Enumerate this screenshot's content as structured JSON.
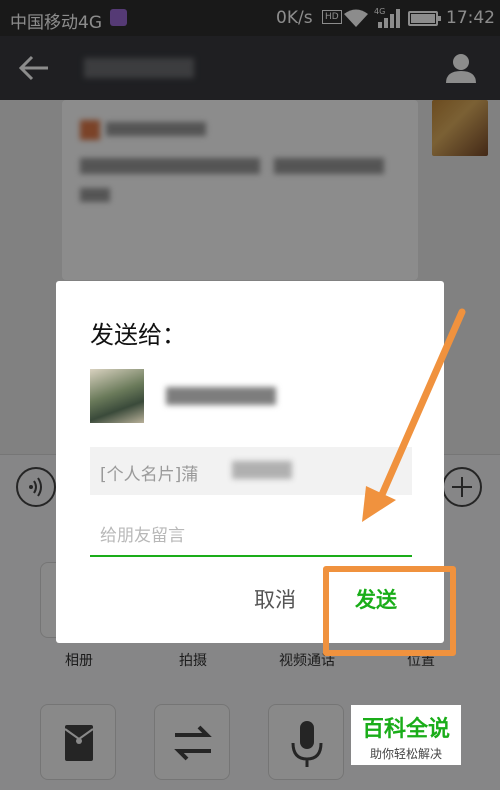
{
  "status_bar": {
    "carrier": "中国移动4G",
    "net_speed": "0K/s",
    "hd_badge": "HD",
    "network_type": "4G",
    "time": "17:42"
  },
  "panel": {
    "items": [
      {
        "label": "相册",
        "icon": "album-icon"
      },
      {
        "label": "拍摄",
        "icon": "camera-icon"
      },
      {
        "label": "视频通话",
        "icon": "video-call-icon"
      },
      {
        "label": "位置",
        "icon": "location-icon"
      }
    ]
  },
  "dialog": {
    "title": "发送给：",
    "card_prefix": "[个人名片]",
    "card_partial": "蒲",
    "message_placeholder": "给朋友留言",
    "cancel_label": "取消",
    "send_label": "发送"
  },
  "watermark": {
    "title": "百科全说",
    "subtitle": "助你轻松解决"
  },
  "colors": {
    "accent_green": "#1aad19",
    "annotation_orange": "#f0923e",
    "titlebar": "#393a3f",
    "statusbar": "#2f2f2f"
  }
}
